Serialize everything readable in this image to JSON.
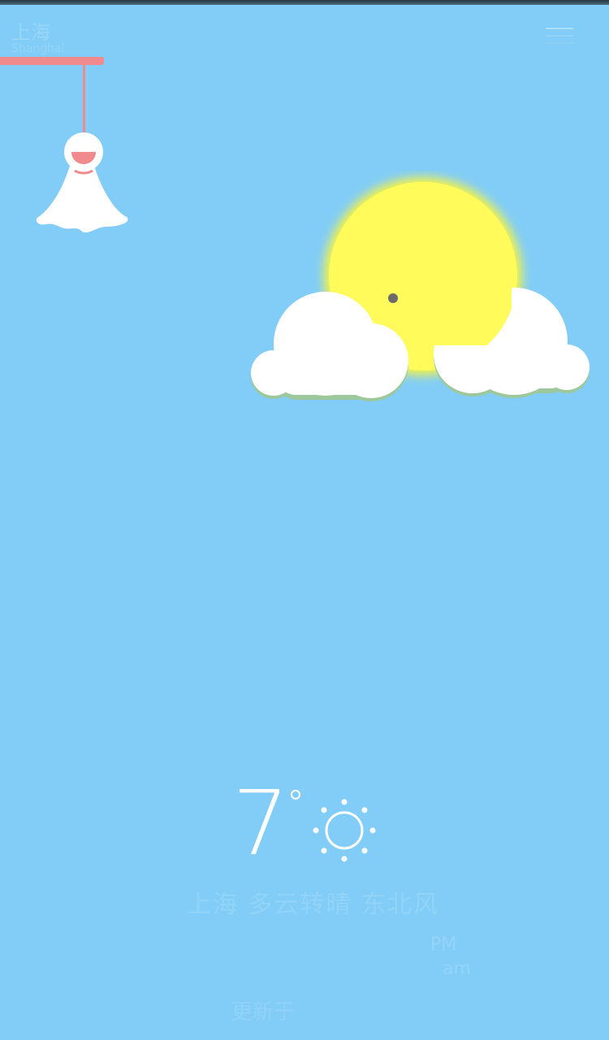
{
  "header": {
    "city": "上海",
    "city_sub": "Shanghai"
  },
  "weather": {
    "temperature": "7",
    "condition_icon": "sun-outline-icon",
    "description": "上海 多云转晴 东北风",
    "detail_1": "PM",
    "detail_2": "am",
    "detail_3": "更新于"
  },
  "colors": {
    "sky": "#82cdf7",
    "sun": "#fefb5b",
    "cloud": "#ffffff",
    "accent": "#f08a8d"
  },
  "icons": {
    "menu": "menu-icon",
    "doll": "teru-teru-bozu-icon",
    "mascot": "sun-behind-cloud-illustration"
  }
}
